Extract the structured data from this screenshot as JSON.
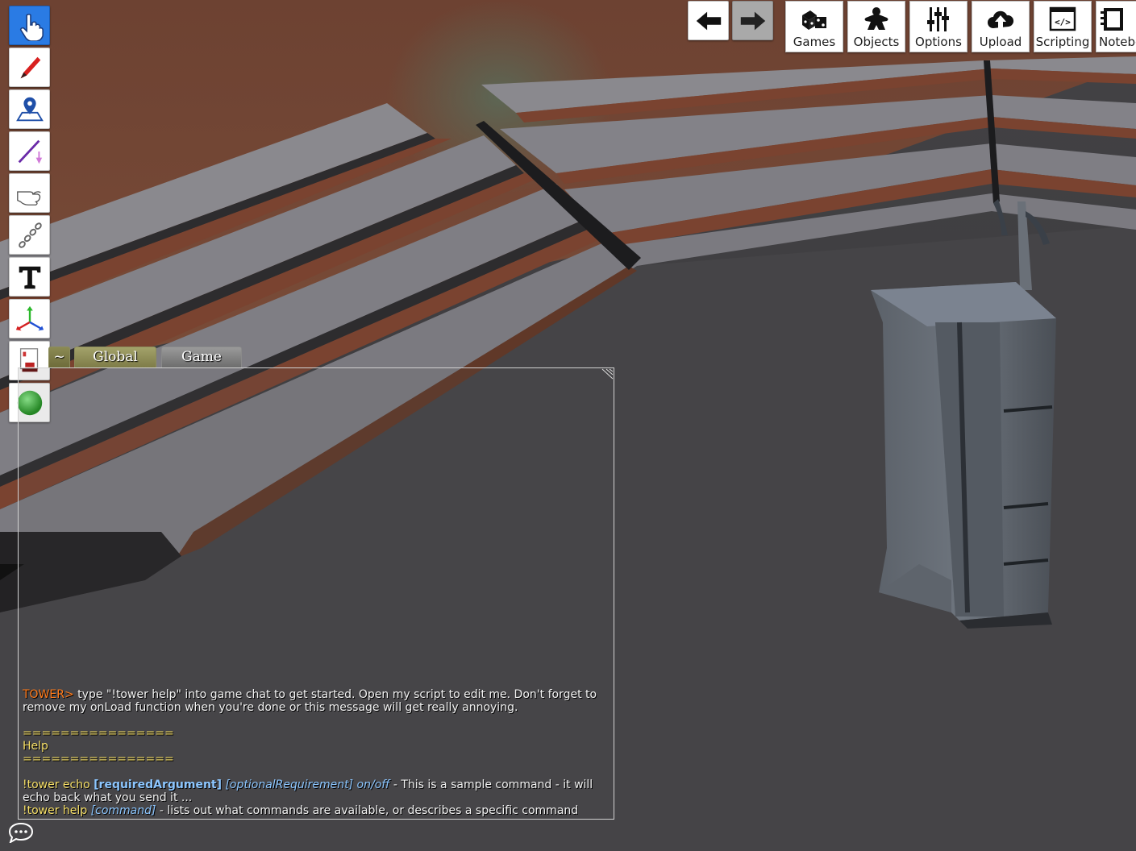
{
  "toolbar_left": [
    {
      "name": "grab-tool",
      "icon": "pointer-hand-icon",
      "active": true
    },
    {
      "name": "draw-tool",
      "icon": "pencil-icon"
    },
    {
      "name": "flick-tool",
      "icon": "map-pin-icon"
    },
    {
      "name": "line-tool",
      "icon": "line-arrow-icon"
    },
    {
      "name": "gizmo-tool",
      "icon": "pinch-hand-icon"
    },
    {
      "name": "joint-tool",
      "icon": "chain-icon"
    },
    {
      "name": "text-tool",
      "icon": "text-t-icon"
    },
    {
      "name": "axis-tool",
      "icon": "xyz-axes-icon"
    },
    {
      "name": "decal-tool",
      "icon": "decal-stamp-icon"
    },
    {
      "name": "player-color",
      "icon": "green-sphere-icon",
      "color": "#2fb52f"
    }
  ],
  "nav": {
    "back_icon": "arrow-left-icon",
    "forward_icon": "arrow-right-icon"
  },
  "menu": {
    "games": "Games",
    "objects": "Objects",
    "options": "Options",
    "upload": "Upload",
    "scripting": "Scripting",
    "notebook": "Notebo"
  },
  "chat": {
    "tilde": "~",
    "tabs": [
      "Global",
      "Game"
    ],
    "line1_prefix": "TOWER>",
    "line1_text": " type \"!tower help\" into game chat to get started. Open my script to edit me. Don't forget to remove my onLoad function when you're done or this message will get really annoying.",
    "rule": "================",
    "help_title": "Help",
    "cmd1_name": "!tower echo",
    "cmd1_req": "[requiredArgument]",
    "cmd1_opt": "[optionalRequirement] on/off",
    "cmd1_desc": " - This is a sample command - it will echo back what you send it ...",
    "cmd2_name": "!tower help",
    "cmd2_opt": "[command]",
    "cmd2_desc": " - lists out what commands are available, or describes a specific command"
  },
  "chat_toggle_icon": "speech-bubble-icon",
  "colors": {
    "active_tool": "#2a7be4",
    "tower_orange": "#ff7a1a",
    "help_yellow": "#f6df67",
    "arg_blue": "#8cc6ff",
    "table_surface": "#3c3b3d",
    "bench": "#807f85",
    "wall": "#6f4535"
  }
}
